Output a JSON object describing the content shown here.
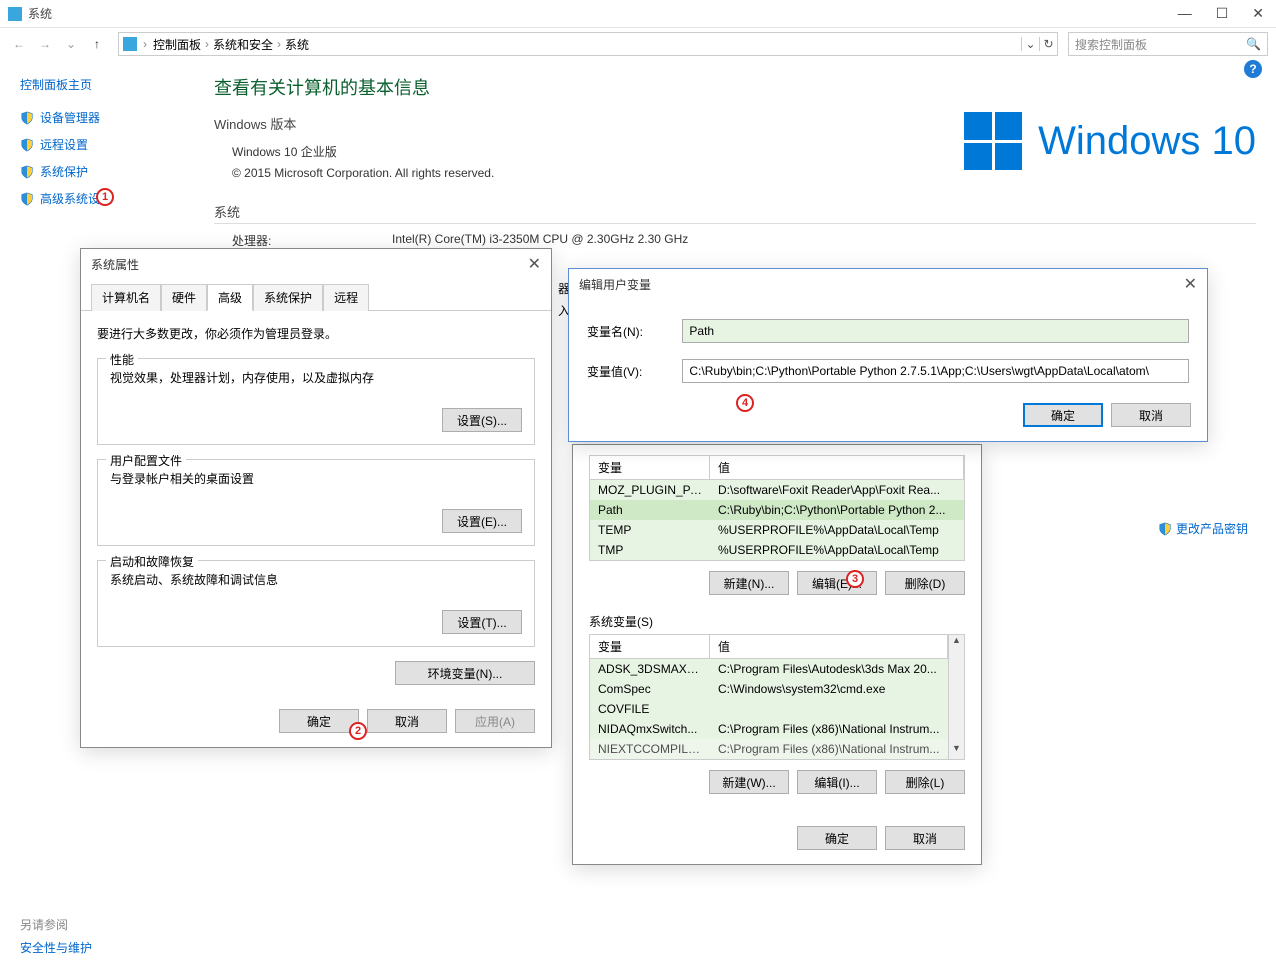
{
  "window": {
    "title": "系统",
    "search_placeholder": "搜索控制面板"
  },
  "breadcrumb": [
    "控制面板",
    "系统和安全",
    "系统"
  ],
  "sidebar": {
    "home": "控制面板主页",
    "items": [
      "设备管理器",
      "远程设置",
      "系统保护",
      "高级系统设置"
    ]
  },
  "page": {
    "heading": "查看有关计算机的基本信息",
    "win_edition_h": "Windows 版本",
    "edition": "Windows 10 企业版",
    "copyright": "© 2015 Microsoft Corporation. All rights reserved.",
    "winlogo_text": "Windows 10",
    "system_h": "系统",
    "cpu_label": "处理器:",
    "cpu_value": "Intel(R) Core(TM) i3-2350M CPU @ 2.30GHz   2.30 GHz",
    "change_key": "更改产品密钥",
    "seealso_h": "另请参阅",
    "seealso_link": "安全性与维护"
  },
  "sysprop": {
    "title": "系统属性",
    "tabs": [
      "计算机名",
      "硬件",
      "高级",
      "系统保护",
      "远程"
    ],
    "active_tab": 2,
    "admin_note": "要进行大多数更改，你必须作为管理员登录。",
    "perf_h": "性能",
    "perf_desc": "视觉效果，处理器计划，内存使用，以及虚拟内存",
    "perf_btn": "设置(S)...",
    "profile_h": "用户配置文件",
    "profile_desc": "与登录帐户相关的桌面设置",
    "profile_btn": "设置(E)...",
    "startup_h": "启动和故障恢复",
    "startup_desc": "系统启动、系统故障和调试信息",
    "startup_btn": "设置(T)...",
    "envvar_btn": "环境变量(N)...",
    "ok": "确定",
    "cancel": "取消",
    "apply": "应用(A)"
  },
  "envdlg": {
    "uservars_hdr_var": "变量",
    "uservars_hdr_val": "值",
    "user_rows": [
      {
        "k": "MOZ_PLUGIN_PA...",
        "v": "D:\\software\\Foxit Reader\\App\\Foxit Rea..."
      },
      {
        "k": "Path",
        "v": "C:\\Ruby\\bin;C:\\Python\\Portable Python 2..."
      },
      {
        "k": "TEMP",
        "v": "%USERPROFILE%\\AppData\\Local\\Temp"
      },
      {
        "k": "TMP",
        "v": "%USERPROFILE%\\AppData\\Local\\Temp"
      }
    ],
    "new_n": "新建(N)...",
    "edit_e": "编辑(E)...",
    "del_d": "删除(D)",
    "sysvars_h": "系统变量(S)",
    "sys_rows": [
      {
        "k": "ADSK_3DSMAX_x...",
        "v": "C:\\Program Files\\Autodesk\\3ds Max 20..."
      },
      {
        "k": "ComSpec",
        "v": "C:\\Windows\\system32\\cmd.exe"
      },
      {
        "k": "COVFILE",
        "v": ""
      },
      {
        "k": "NIDAQmxSwitch...",
        "v": "C:\\Program Files (x86)\\National Instrum..."
      },
      {
        "k": "NIEXTCCOMPILE...",
        "v": "C:\\Program Files (x86)\\National Instrum..."
      }
    ],
    "new_w": "新建(W)...",
    "edit_i": "编辑(I)...",
    "del_l": "删除(L)",
    "ok": "确定",
    "cancel": "取消"
  },
  "editdlg": {
    "title": "编辑用户变量",
    "name_label": "变量名(N):",
    "name_value": "Path",
    "value_label": "变量值(V):",
    "value_value": "C:\\Ruby\\bin;C:\\Python\\Portable Python 2.7.5.1\\App;C:\\Users\\wgt\\AppData\\Local\\atom\\",
    "ok": "确定",
    "cancel": "取消"
  },
  "extra": {
    "row1": "器",
    "row2": "入"
  }
}
